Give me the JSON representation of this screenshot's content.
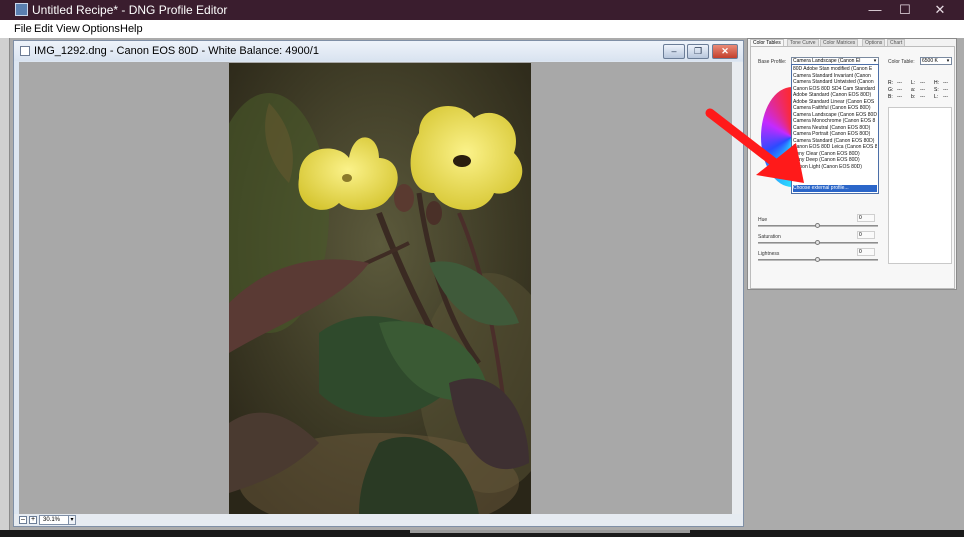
{
  "app": {
    "title": "Untitled Recipe* - DNG Profile Editor",
    "window_controls": {
      "minimize": "—",
      "maximize": "☐",
      "close": "✕"
    }
  },
  "menu": [
    "File",
    "Edit",
    "View",
    "Options",
    "Help"
  ],
  "image_window": {
    "title": "IMG_1292.dng  - Canon EOS 80D - White Balance: 4900/1",
    "controls": {
      "minimize": "–",
      "restore": "❐",
      "close": "✕"
    },
    "zoom": {
      "minus": "–",
      "plus": "+",
      "value": "30.1%",
      "dropdown": "▾"
    }
  },
  "panel": {
    "tabs": [
      "Color Tables",
      "Tone Curve",
      "Color Matrices",
      "Options",
      "Chart"
    ],
    "active_tab": "Color Tables",
    "base_profile_label": "Base Profile:",
    "base_profile_value": "Camera Landscape (Canon EI",
    "color_table_label": "Color Table:",
    "color_table_value": "6500 K",
    "profile_options": [
      "80D Adobe Stan modified (Canon E",
      "Camera Standard Invariant (Canon",
      "Camera Standard Untwisted (Canon",
      "Canon EOS 80D SD4 Cam Standard",
      "Adobe Standard (Canon EOS 80D)",
      "Adobe Standard Linear (Canon EOS",
      "Camera Faithful (Canon EOS 80D)",
      "Camera Landscape (Canon EOS 80D",
      "Camera Monochrome (Canon EOS 8",
      "Camera Neutral (Canon EOS 80D)",
      "Camera Portrait (Canon EOS 80D)",
      "Camera Standard (Canon EOS 80D)",
      "Canon EOS 80D Leica (Canon EOS 8",
      "Sony Clear (Canon EOS 80D)",
      "Sony Deep (Canon EOS 80D)",
      "Canon Light (Canon EOS 80D)",
      "",
      "Choose external profile..."
    ],
    "readout": {
      "row1": [
        "R:",
        "---",
        "L:",
        "---",
        "H:",
        "---"
      ],
      "row2": [
        "G:",
        "---",
        "a:",
        "---",
        "S:",
        "---"
      ],
      "row3": [
        "B:",
        "---",
        "b:",
        "---",
        "L:",
        "---"
      ]
    },
    "sliders": [
      {
        "label": "Hue",
        "value": "0"
      },
      {
        "label": "Saturation",
        "value": "0"
      },
      {
        "label": "Lightness",
        "value": "0"
      }
    ]
  },
  "colors": {
    "titlebar": "#3a1d2e",
    "highlight": "#2b66c9",
    "annotation_arrow": "#ff1a1a"
  }
}
